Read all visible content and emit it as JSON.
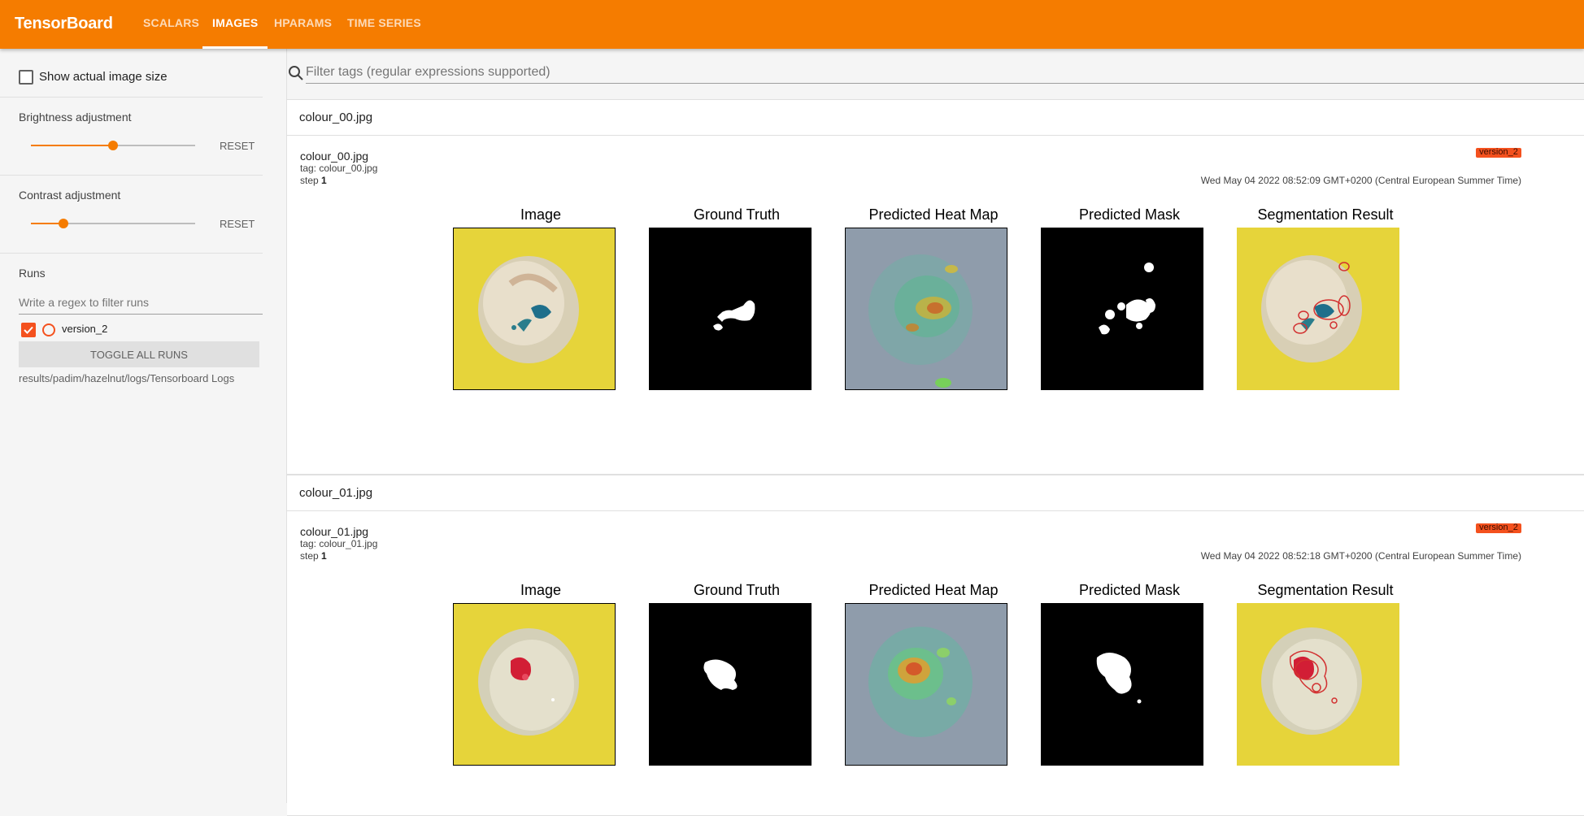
{
  "header": {
    "brand": "TensorBoard",
    "tabs": [
      {
        "label": "SCALARS",
        "active": false
      },
      {
        "label": "IMAGES",
        "active": true
      },
      {
        "label": "HPARAMS",
        "active": false
      },
      {
        "label": "TIME SERIES",
        "active": false
      }
    ]
  },
  "sidebar": {
    "show_actual_size": {
      "label": "Show actual image size",
      "checked": false
    },
    "brightness": {
      "label": "Brightness adjustment",
      "value": 0.5,
      "reset_label": "RESET"
    },
    "contrast": {
      "label": "Contrast adjustment",
      "value": 0.2,
      "reset_label": "RESET"
    },
    "runs": {
      "title": "Runs",
      "filter_placeholder": "Write a regex to filter runs",
      "items": [
        {
          "name": "version_2",
          "checked": true,
          "color": "#f4511e"
        }
      ],
      "toggle_all_label": "TOGGLE ALL RUNS",
      "logdir": "results/padim/hazelnut/logs/Tensorboard Logs"
    }
  },
  "search": {
    "placeholder": "Filter tags (regular expressions supported)"
  },
  "accent_color": "#f57c00",
  "cards": [
    {
      "header": "colour_00.jpg",
      "name": "colour_00.jpg",
      "tag": "tag: colour_00.jpg",
      "step_label": "step",
      "step": "1",
      "run": "version_2",
      "timestamp": "Wed May 04 2022 08:52:09 GMT+0200 (Central European Summer Time)",
      "panels": [
        "Image",
        "Ground Truth",
        "Predicted Heat Map",
        "Predicted Mask",
        "Segmentation Result"
      ],
      "defect_color": "blue"
    },
    {
      "header": "colour_01.jpg",
      "name": "colour_01.jpg",
      "tag": "tag: colour_01.jpg",
      "step_label": "step",
      "step": "1",
      "run": "version_2",
      "timestamp": "Wed May 04 2022 08:52:18 GMT+0200 (Central European Summer Time)",
      "panels": [
        "Image",
        "Ground Truth",
        "Predicted Heat Map",
        "Predicted Mask",
        "Segmentation Result"
      ],
      "defect_color": "red"
    }
  ]
}
